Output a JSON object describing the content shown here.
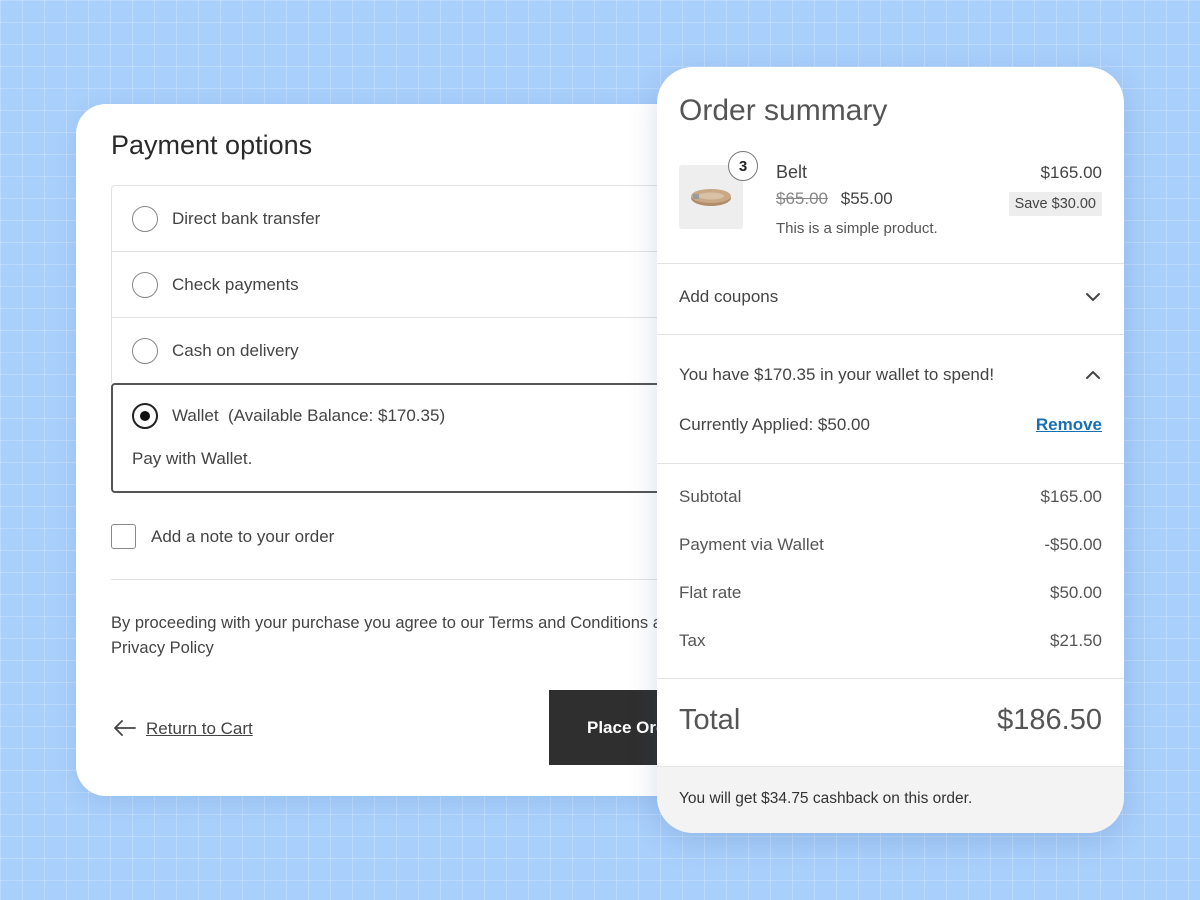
{
  "payment": {
    "title": "Payment options",
    "options": [
      {
        "label": "Direct bank transfer",
        "selected": false
      },
      {
        "label": "Check payments",
        "selected": false
      },
      {
        "label": "Cash on delivery",
        "selected": false
      },
      {
        "label": "Wallet  (Available Balance: $170.35)",
        "selected": true,
        "description": "Pay with Wallet."
      }
    ],
    "note_label": "Add a note to your order",
    "terms_text": "By proceeding with your purchase you agree to our Terms and Conditions and Privacy Policy",
    "return_label": "Return to Cart",
    "place_order_label": "Place Order"
  },
  "summary": {
    "title": "Order summary",
    "item": {
      "quantity": "3",
      "name": "Belt",
      "old_price": "$65.00",
      "price": "$55.00",
      "description": "This is a simple product.",
      "line_total": "$165.00",
      "save_label": "Save $30.00"
    },
    "coupon_label": "Add coupons",
    "wallet_text": "You have $170.35 in your wallet to spend!",
    "applied_text": "Currently Applied: $50.00",
    "remove_label": "Remove",
    "totals": [
      {
        "label": "Subtotal",
        "value": "$165.00"
      },
      {
        "label": "Payment via Wallet",
        "value": "-$50.00"
      },
      {
        "label": "Flat rate",
        "value": "$50.00"
      },
      {
        "label": "Tax",
        "value": "$21.50"
      }
    ],
    "total_label": "Total",
    "total_value": "$186.50",
    "cashback_text": "You will get $34.75 cashback on this order."
  },
  "colors": {
    "background": "#a9cffc",
    "button_dark": "#2f2f2f",
    "link_blue": "#1a6fb3"
  }
}
